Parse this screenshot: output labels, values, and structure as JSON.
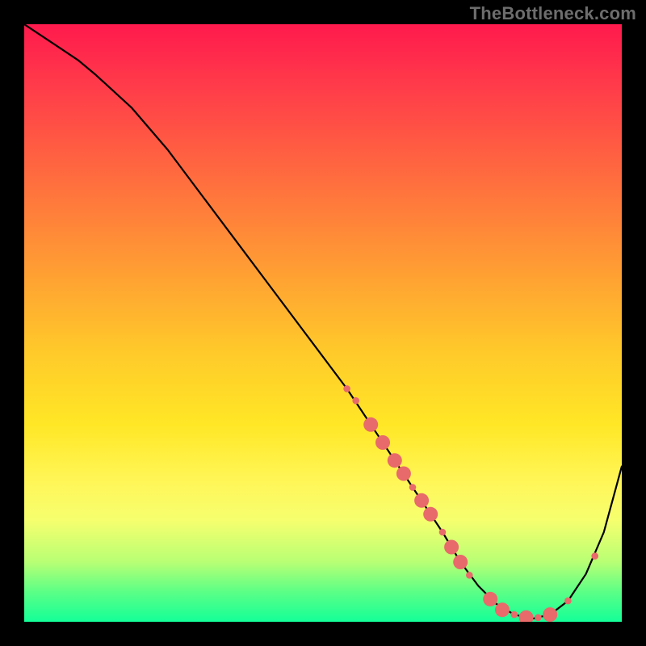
{
  "watermark": "TheBottleneck.com",
  "chart_data": {
    "type": "line",
    "title": "",
    "xlabel": "",
    "ylabel": "",
    "xlim": [
      0,
      100
    ],
    "ylim": [
      0,
      100
    ],
    "grid": false,
    "series": [
      {
        "name": "curve",
        "x": [
          0,
          3,
          6,
          9,
          12,
          18,
          24,
          30,
          36,
          42,
          48,
          54,
          58,
          62,
          66,
          70,
          73,
          76,
          79,
          82,
          85,
          88,
          91,
          94,
          97,
          100
        ],
        "y": [
          100,
          98,
          96,
          94,
          91.5,
          86,
          79,
          71,
          63,
          55,
          47,
          39,
          33,
          27,
          21,
          15,
          10,
          6,
          3,
          1.2,
          0.5,
          1.2,
          3.5,
          8,
          15,
          26
        ]
      }
    ],
    "markers": [
      {
        "x": 54,
        "y": 39,
        "r": 1.2
      },
      {
        "x": 55.5,
        "y": 37,
        "r": 1.2
      },
      {
        "x": 58,
        "y": 33,
        "r": 2.5
      },
      {
        "x": 60,
        "y": 30,
        "r": 2.5
      },
      {
        "x": 62,
        "y": 27,
        "r": 2.5
      },
      {
        "x": 63.5,
        "y": 24.8,
        "r": 2.5
      },
      {
        "x": 65,
        "y": 22.5,
        "r": 1.2
      },
      {
        "x": 66.5,
        "y": 20.3,
        "r": 2.5
      },
      {
        "x": 68,
        "y": 18,
        "r": 2.5
      },
      {
        "x": 70,
        "y": 15,
        "r": 1.2
      },
      {
        "x": 71.5,
        "y": 12.5,
        "r": 2.5
      },
      {
        "x": 73,
        "y": 10,
        "r": 2.5
      },
      {
        "x": 74.5,
        "y": 7.8,
        "r": 1.2
      },
      {
        "x": 78,
        "y": 3.8,
        "r": 2.5
      },
      {
        "x": 80,
        "y": 2.0,
        "r": 2.5
      },
      {
        "x": 82,
        "y": 1.2,
        "r": 1.2
      },
      {
        "x": 84,
        "y": 0.7,
        "r": 2.5
      },
      {
        "x": 86,
        "y": 0.7,
        "r": 1.2
      },
      {
        "x": 88,
        "y": 1.2,
        "r": 2.5
      },
      {
        "x": 91,
        "y": 3.5,
        "r": 1.2
      },
      {
        "x": 95.5,
        "y": 11,
        "r": 1.2
      }
    ],
    "marker_color": "#e86a6a",
    "curve_color": "#000000"
  }
}
